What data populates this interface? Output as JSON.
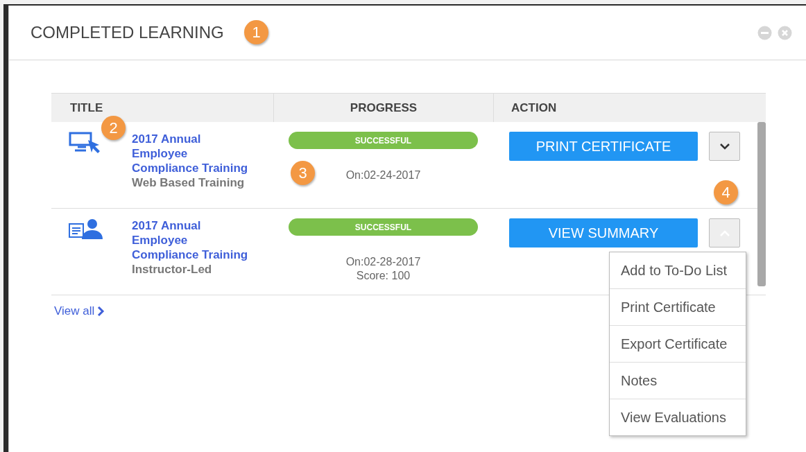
{
  "panel": {
    "title": "COMPLETED LEARNING",
    "callout": "1"
  },
  "table": {
    "columns": [
      "TITLE",
      "PROGRESS",
      "ACTION"
    ],
    "rows": [
      {
        "kind": "web",
        "title_lines": [
          "2017 Annual",
          "Employee",
          "Compliance Training"
        ],
        "type": "Web Based Training",
        "icon_callout": "2",
        "status": "SUCCESSFUL",
        "details": [
          "On:02-24-2017"
        ],
        "progress_callout": "3",
        "action": "PRINT CERTIFICATE",
        "expanded": false,
        "action_callout": "4"
      },
      {
        "kind": "instructor",
        "title_lines": [
          "2017 Annual",
          "Employee",
          "Compliance Training"
        ],
        "type": "Instructor-Led",
        "status": "SUCCESSFUL",
        "details": [
          "On:02-28-2017",
          "Score: 100"
        ],
        "action": "VIEW SUMMARY",
        "expanded": true,
        "menu": [
          "Add to To-Do List",
          "Print Certificate",
          "Export Certificate",
          "Notes",
          "View Evaluations"
        ]
      }
    ]
  },
  "view_all": "View all"
}
